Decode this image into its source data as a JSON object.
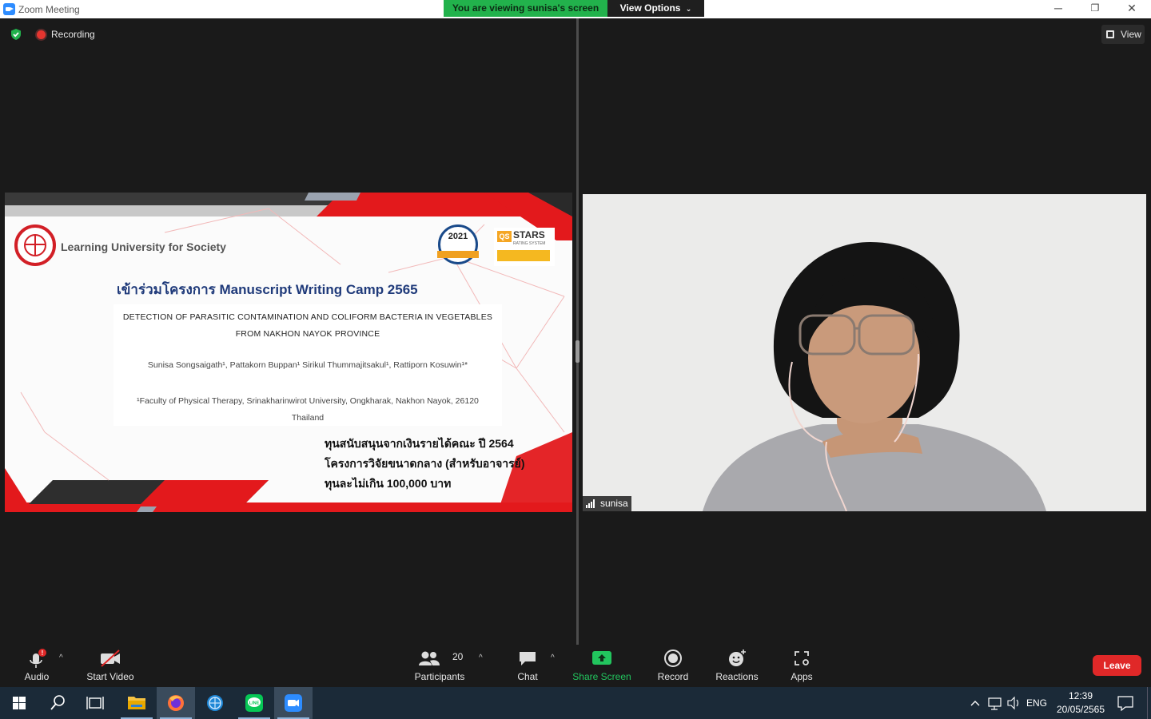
{
  "window": {
    "title": "Zoom Meeting",
    "viewing_banner": "You are viewing sunisa's screen",
    "view_options": "View Options",
    "minimize": "─",
    "restore": "❐",
    "close": "✕"
  },
  "status": {
    "recording": "Recording",
    "view": "View"
  },
  "slide": {
    "slogan": "Learning University for Society",
    "badge_year": "2021",
    "qs_logo": "QS",
    "qs_stars": "STARS",
    "qs_rating": "RATING SYSTEM",
    "title": "เข้าร่วมโครงการ Manuscript Writing Camp 2565",
    "paper_title_line1": "DETECTION OF PARASITIC CONTAMINATION AND COLIFORM BACTERIA IN VEGETABLES",
    "paper_title_line2": "FROM NAKHON NAYOK PROVINCE",
    "authors": "Sunisa Songsaigath¹, Pattakorn Buppan¹ Sirikul Thummajitsakul¹, Rattiporn Kosuwin¹*",
    "affiliation_line1": "¹Faculty of Physical Therapy, Srinakharinwirot University, Ongkharak, Nakhon Nayok, 26120",
    "affiliation_line2": "Thailand",
    "funding_line1": "ทุนสนับสนุนจากเงินรายได้คณะ ปี 2564",
    "funding_line2": "โครงการวิจัยขนาดกลาง (สำหรับอาจารย์)",
    "funding_line3": "ทุนละไม่เกิน 100,000 บาท"
  },
  "participant": {
    "name": "sunisa"
  },
  "toolbar": {
    "audio": "Audio",
    "start_video": "Start Video",
    "participants": "Participants",
    "participants_count": "20",
    "chat": "Chat",
    "share_screen": "Share Screen",
    "record": "Record",
    "reactions": "Reactions",
    "apps": "Apps",
    "leave": "Leave",
    "caret": "^"
  },
  "taskbar": {
    "language": "ENG",
    "time": "12:39",
    "date": "20/05/2565"
  },
  "colors": {
    "accent_green": "#22b24c",
    "leave_red": "#e02828",
    "slide_red": "#e3191c",
    "taskbar_bg": "#1b2a38"
  }
}
